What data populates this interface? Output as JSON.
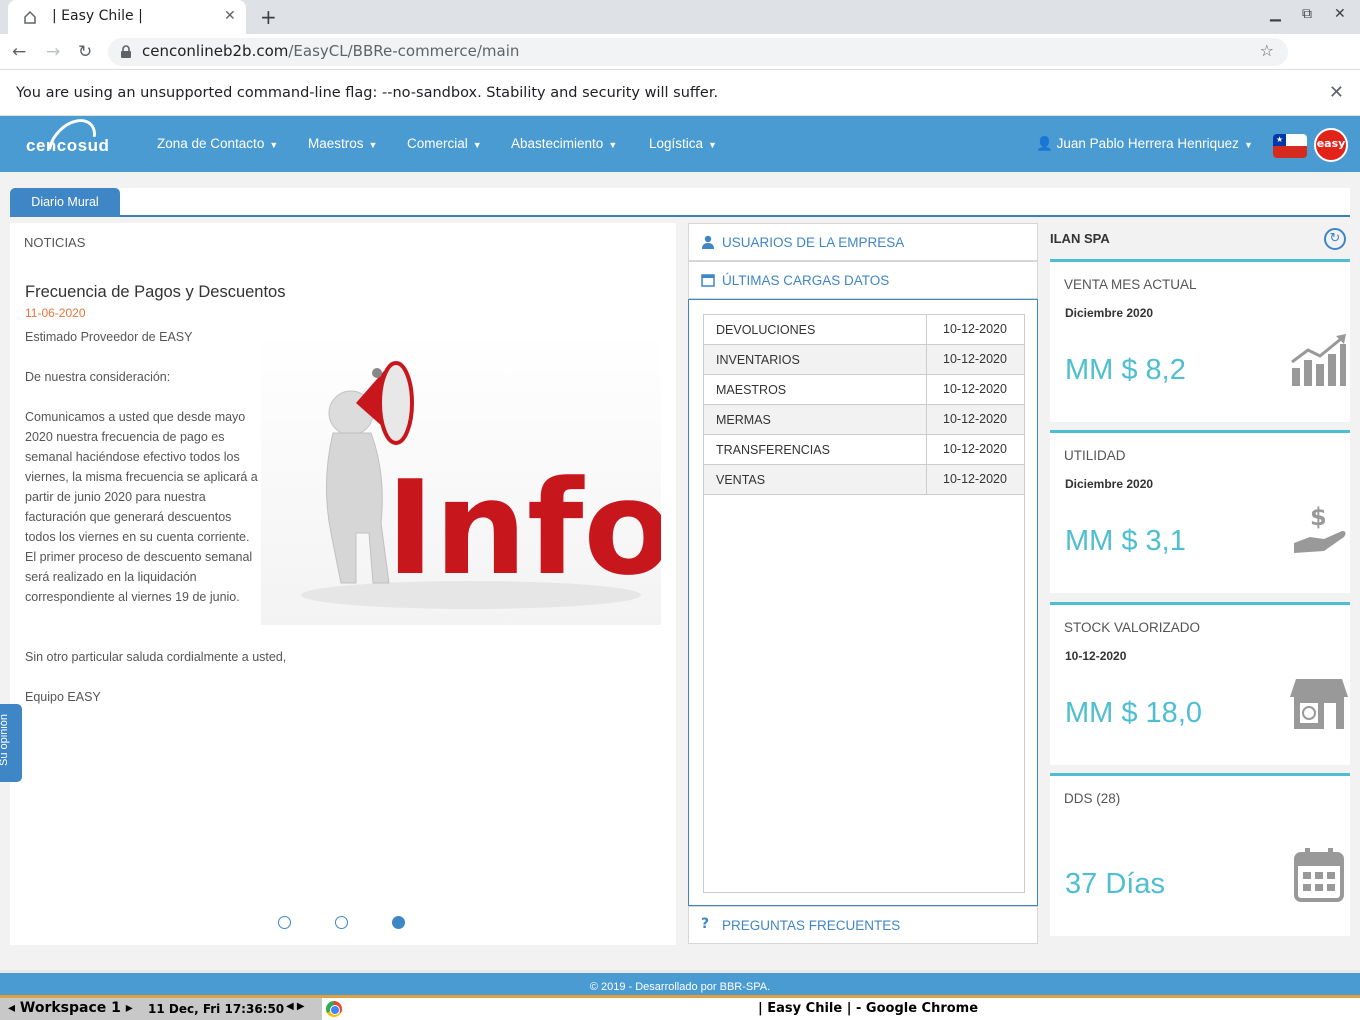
{
  "browser": {
    "tab_title": "| Easy Chile |",
    "url_host": "cenconlineb2b.com",
    "url_path": "/EasyCL/BBRe-commerce/main",
    "infobar_message": "You are using an unsupported command-line flag: --no-sandbox. Stability and security will suffer."
  },
  "nav": {
    "logo": "cencosud",
    "menus": [
      "Zona de Contacto",
      "Maestros",
      "Comercial",
      "Abastecimiento",
      "Logística"
    ],
    "user": "Juan Pablo Herrera Henriquez",
    "brand_badge": "easy"
  },
  "tabs": {
    "active": "Diario Mural"
  },
  "news": {
    "header": "NOTICIAS",
    "title": "Frecuencia de Pagos y Descuentos",
    "date": "11-06-2020",
    "p1": "Estimado Proveedor de EASY",
    "p2": "De nuestra consideración:",
    "p3": "Comunicamos a usted que desde mayo 2020 nuestra frecuencia de pago es semanal haciéndose efectivo todos los viernes, la misma frecuencia se aplicará a partir de junio 2020 para nuestra facturación que generará descuentos todos los viernes en su cuenta corriente. El primer proceso de descuento semanal será realizado en la liquidación correspondiente al viernes 19 de junio.",
    "p4": "Sin otro particular saluda cordialmente a usted,",
    "p5": "Equipo EASY",
    "image_text": "Info",
    "carousel_active": 3,
    "carousel_count": 3
  },
  "feedback_tab": "Su opinión",
  "middle": {
    "users_label": "USUARIOS DE LA EMPRESA",
    "loads_label": "ÚLTIMAS CARGAS DATOS",
    "faq_label": "PREGUNTAS FRECUENTES",
    "rows": [
      {
        "name": "DEVOLUCIONES",
        "date": "10-12-2020"
      },
      {
        "name": "INVENTARIOS",
        "date": "10-12-2020"
      },
      {
        "name": "MAESTROS",
        "date": "10-12-2020"
      },
      {
        "name": "MERMAS",
        "date": "10-12-2020"
      },
      {
        "name": "TRANSFERENCIAS",
        "date": "10-12-2020"
      },
      {
        "name": "VENTAS",
        "date": "10-12-2020"
      }
    ]
  },
  "right": {
    "company": "ILAN SPA",
    "cards": [
      {
        "title": "VENTA MES ACTUAL",
        "sub": "Diciembre 2020",
        "value": "MM $ 8,2",
        "icon": "chart-icon"
      },
      {
        "title": "UTILIDAD",
        "sub": "Diciembre 2020",
        "value": "MM $ 3,1",
        "icon": "money-hand-icon"
      },
      {
        "title": "STOCK VALORIZADO",
        "sub": "10-12-2020",
        "value": "MM $ 18,0",
        "icon": "store-icon"
      },
      {
        "title": "DDS (28)",
        "sub": "",
        "value": "37 Días",
        "icon": "calendar-icon"
      }
    ]
  },
  "footer": "© 2019 - Desarrollado por BBR-SPA.",
  "taskbar": {
    "workspace": "Workspace 1",
    "clock": "11 Dec, Fri 17:36:50",
    "window_title": "| Easy Chile | - Google Chrome"
  },
  "colors": {
    "primary": "#4b9bd3",
    "accent": "#3f86c6",
    "kpi": "#4dbfd0",
    "news_date": "#e8743b"
  }
}
